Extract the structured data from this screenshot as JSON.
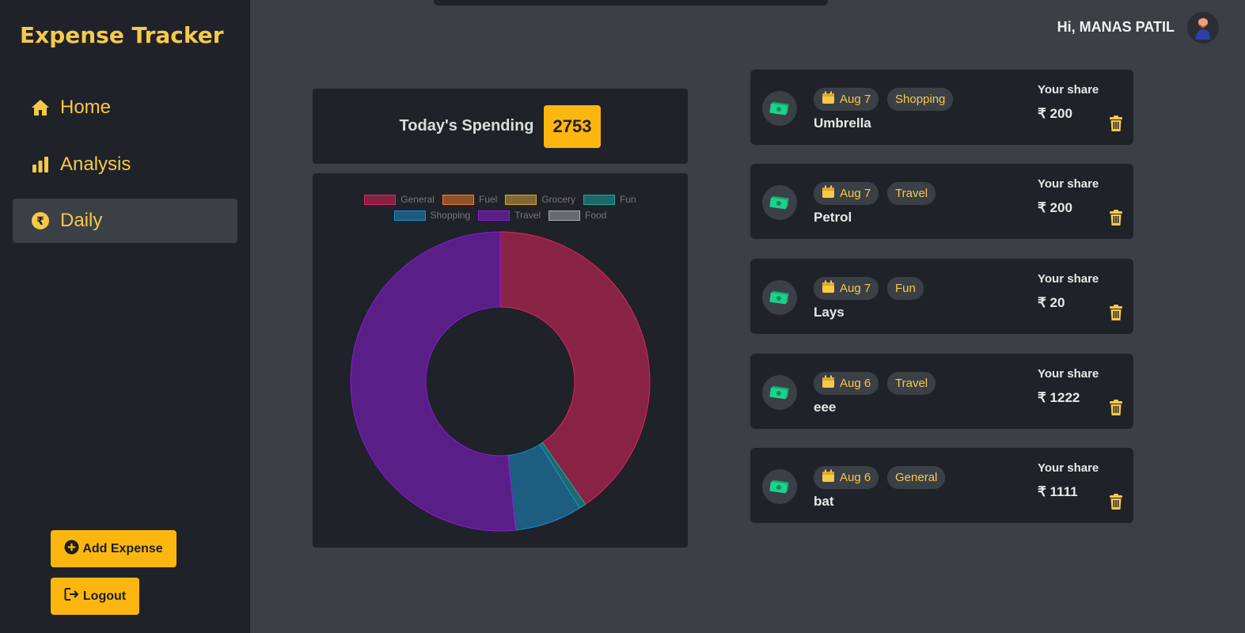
{
  "app": {
    "title": "Expense Tracker"
  },
  "nav": {
    "items": [
      {
        "label": "Home",
        "icon": "home-icon"
      },
      {
        "label": "Analysis",
        "icon": "bar-chart-icon"
      },
      {
        "label": "Daily",
        "icon": "rupee-icon",
        "active": true
      }
    ]
  },
  "actions": {
    "add_expense": "Add Expense",
    "logout": "Logout"
  },
  "header": {
    "greeting": "Hi, MANAS PATIL"
  },
  "spending": {
    "label": "Today's Spending",
    "value": "2753"
  },
  "colors": {
    "accent": "#fbb70f",
    "brand": "#f7c94a",
    "panel": "#1f2228",
    "background": "#3b3f46"
  },
  "chart_data": {
    "type": "pie",
    "donut": true,
    "legend_position": "top",
    "categories": [
      "General",
      "Fuel",
      "Grocery",
      "Fun",
      "Shopping",
      "Travel",
      "Food"
    ],
    "values": [
      1111,
      0,
      0,
      20,
      200,
      1422,
      0
    ],
    "colors": [
      "#e0245e",
      "#f47c2a",
      "#d8a63a",
      "#1aa6a0",
      "#1a8ec9",
      "#8a1cd6",
      "#aaaaaa"
    ]
  },
  "share_label": "Your share",
  "expenses": [
    {
      "date": "Aug 7",
      "category": "Shopping",
      "name": "Umbrella",
      "amount": "₹ 200"
    },
    {
      "date": "Aug 7",
      "category": "Travel",
      "name": "Petrol",
      "amount": "₹ 200"
    },
    {
      "date": "Aug 7",
      "category": "Fun",
      "name": "Lays",
      "amount": "₹ 20"
    },
    {
      "date": "Aug 6",
      "category": "Travel",
      "name": "eee",
      "amount": "₹ 1222"
    },
    {
      "date": "Aug 6",
      "category": "General",
      "name": "bat",
      "amount": "₹ 1111"
    }
  ]
}
